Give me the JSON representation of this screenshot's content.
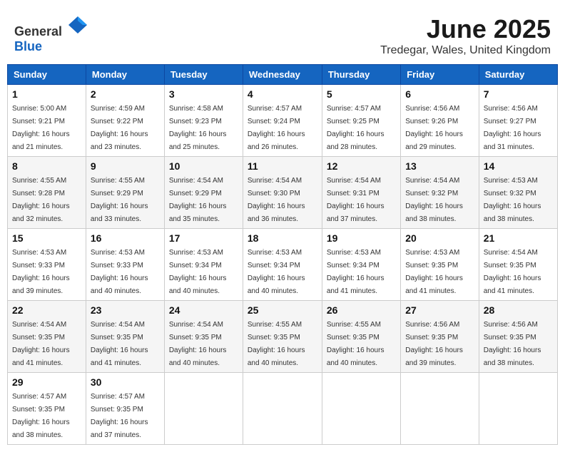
{
  "header": {
    "logo_general": "General",
    "logo_blue": "Blue",
    "month": "June 2025",
    "location": "Tredegar, Wales, United Kingdom"
  },
  "weekdays": [
    "Sunday",
    "Monday",
    "Tuesday",
    "Wednesday",
    "Thursday",
    "Friday",
    "Saturday"
  ],
  "weeks": [
    [
      {
        "day": "1",
        "sunrise": "Sunrise: 5:00 AM",
        "sunset": "Sunset: 9:21 PM",
        "daylight": "Daylight: 16 hours and 21 minutes."
      },
      {
        "day": "2",
        "sunrise": "Sunrise: 4:59 AM",
        "sunset": "Sunset: 9:22 PM",
        "daylight": "Daylight: 16 hours and 23 minutes."
      },
      {
        "day": "3",
        "sunrise": "Sunrise: 4:58 AM",
        "sunset": "Sunset: 9:23 PM",
        "daylight": "Daylight: 16 hours and 25 minutes."
      },
      {
        "day": "4",
        "sunrise": "Sunrise: 4:57 AM",
        "sunset": "Sunset: 9:24 PM",
        "daylight": "Daylight: 16 hours and 26 minutes."
      },
      {
        "day": "5",
        "sunrise": "Sunrise: 4:57 AM",
        "sunset": "Sunset: 9:25 PM",
        "daylight": "Daylight: 16 hours and 28 minutes."
      },
      {
        "day": "6",
        "sunrise": "Sunrise: 4:56 AM",
        "sunset": "Sunset: 9:26 PM",
        "daylight": "Daylight: 16 hours and 29 minutes."
      },
      {
        "day": "7",
        "sunrise": "Sunrise: 4:56 AM",
        "sunset": "Sunset: 9:27 PM",
        "daylight": "Daylight: 16 hours and 31 minutes."
      }
    ],
    [
      {
        "day": "8",
        "sunrise": "Sunrise: 4:55 AM",
        "sunset": "Sunset: 9:28 PM",
        "daylight": "Daylight: 16 hours and 32 minutes."
      },
      {
        "day": "9",
        "sunrise": "Sunrise: 4:55 AM",
        "sunset": "Sunset: 9:29 PM",
        "daylight": "Daylight: 16 hours and 33 minutes."
      },
      {
        "day": "10",
        "sunrise": "Sunrise: 4:54 AM",
        "sunset": "Sunset: 9:29 PM",
        "daylight": "Daylight: 16 hours and 35 minutes."
      },
      {
        "day": "11",
        "sunrise": "Sunrise: 4:54 AM",
        "sunset": "Sunset: 9:30 PM",
        "daylight": "Daylight: 16 hours and 36 minutes."
      },
      {
        "day": "12",
        "sunrise": "Sunrise: 4:54 AM",
        "sunset": "Sunset: 9:31 PM",
        "daylight": "Daylight: 16 hours and 37 minutes."
      },
      {
        "day": "13",
        "sunrise": "Sunrise: 4:54 AM",
        "sunset": "Sunset: 9:32 PM",
        "daylight": "Daylight: 16 hours and 38 minutes."
      },
      {
        "day": "14",
        "sunrise": "Sunrise: 4:53 AM",
        "sunset": "Sunset: 9:32 PM",
        "daylight": "Daylight: 16 hours and 38 minutes."
      }
    ],
    [
      {
        "day": "15",
        "sunrise": "Sunrise: 4:53 AM",
        "sunset": "Sunset: 9:33 PM",
        "daylight": "Daylight: 16 hours and 39 minutes."
      },
      {
        "day": "16",
        "sunrise": "Sunrise: 4:53 AM",
        "sunset": "Sunset: 9:33 PM",
        "daylight": "Daylight: 16 hours and 40 minutes."
      },
      {
        "day": "17",
        "sunrise": "Sunrise: 4:53 AM",
        "sunset": "Sunset: 9:34 PM",
        "daylight": "Daylight: 16 hours and 40 minutes."
      },
      {
        "day": "18",
        "sunrise": "Sunrise: 4:53 AM",
        "sunset": "Sunset: 9:34 PM",
        "daylight": "Daylight: 16 hours and 40 minutes."
      },
      {
        "day": "19",
        "sunrise": "Sunrise: 4:53 AM",
        "sunset": "Sunset: 9:34 PM",
        "daylight": "Daylight: 16 hours and 41 minutes."
      },
      {
        "day": "20",
        "sunrise": "Sunrise: 4:53 AM",
        "sunset": "Sunset: 9:35 PM",
        "daylight": "Daylight: 16 hours and 41 minutes."
      },
      {
        "day": "21",
        "sunrise": "Sunrise: 4:54 AM",
        "sunset": "Sunset: 9:35 PM",
        "daylight": "Daylight: 16 hours and 41 minutes."
      }
    ],
    [
      {
        "day": "22",
        "sunrise": "Sunrise: 4:54 AM",
        "sunset": "Sunset: 9:35 PM",
        "daylight": "Daylight: 16 hours and 41 minutes."
      },
      {
        "day": "23",
        "sunrise": "Sunrise: 4:54 AM",
        "sunset": "Sunset: 9:35 PM",
        "daylight": "Daylight: 16 hours and 41 minutes."
      },
      {
        "day": "24",
        "sunrise": "Sunrise: 4:54 AM",
        "sunset": "Sunset: 9:35 PM",
        "daylight": "Daylight: 16 hours and 40 minutes."
      },
      {
        "day": "25",
        "sunrise": "Sunrise: 4:55 AM",
        "sunset": "Sunset: 9:35 PM",
        "daylight": "Daylight: 16 hours and 40 minutes."
      },
      {
        "day": "26",
        "sunrise": "Sunrise: 4:55 AM",
        "sunset": "Sunset: 9:35 PM",
        "daylight": "Daylight: 16 hours and 40 minutes."
      },
      {
        "day": "27",
        "sunrise": "Sunrise: 4:56 AM",
        "sunset": "Sunset: 9:35 PM",
        "daylight": "Daylight: 16 hours and 39 minutes."
      },
      {
        "day": "28",
        "sunrise": "Sunrise: 4:56 AM",
        "sunset": "Sunset: 9:35 PM",
        "daylight": "Daylight: 16 hours and 38 minutes."
      }
    ],
    [
      {
        "day": "29",
        "sunrise": "Sunrise: 4:57 AM",
        "sunset": "Sunset: 9:35 PM",
        "daylight": "Daylight: 16 hours and 38 minutes."
      },
      {
        "day": "30",
        "sunrise": "Sunrise: 4:57 AM",
        "sunset": "Sunset: 9:35 PM",
        "daylight": "Daylight: 16 hours and 37 minutes."
      },
      null,
      null,
      null,
      null,
      null
    ]
  ]
}
